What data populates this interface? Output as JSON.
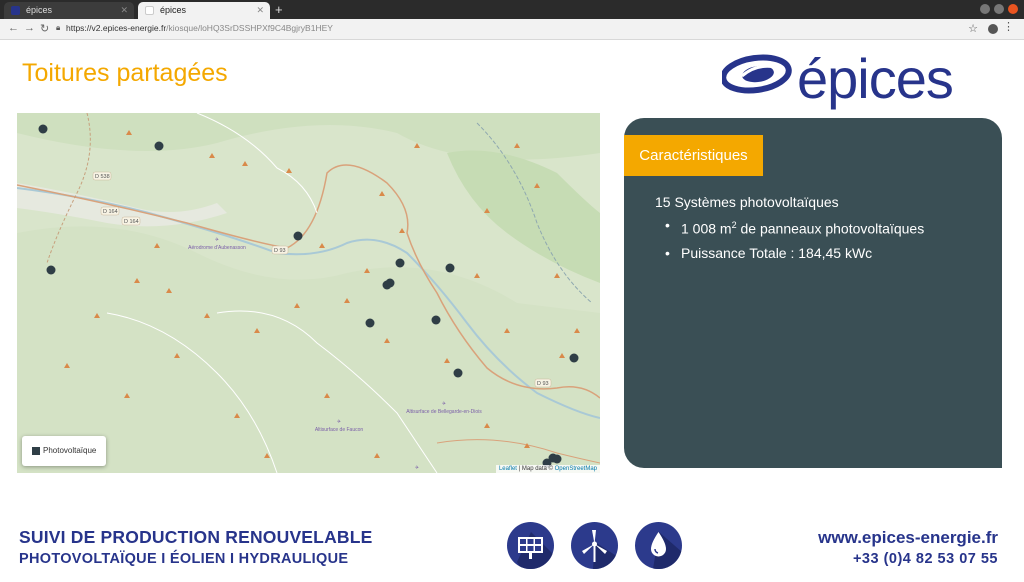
{
  "browser": {
    "tabs": [
      {
        "label": "épices",
        "active": false
      },
      {
        "label": "épices",
        "active": true
      }
    ],
    "url_host": "https://v2.epices-energie.fr",
    "url_path": "/kiosque/loHQ3SrDSSHPXf9C4BgjryB1HEY"
  },
  "page": {
    "title": "Toitures partagées",
    "logo_text": "épices"
  },
  "map": {
    "roads": [
      "D 538",
      "D 164",
      "D 164",
      "D 93",
      "D 93"
    ],
    "places": [
      "Aérodrome d'Aubenasson",
      "Altisurface de Bellegarde-en-Diois",
      "Altisurface de Faucon"
    ],
    "legend_label": "Photovoltaïque",
    "attribution_leaflet": "Leaflet",
    "attribution_sep": " | Map data © ",
    "attribution_osm": "OpenStreetMap",
    "marker_color": "#2f3e46"
  },
  "panel": {
    "tag": "Caractéristiques",
    "headline": "15 Systèmes photovoltaïques",
    "item1_pre": "1 008 m",
    "item1_sup": "2",
    "item1_post": " de panneaux photovoltaïques",
    "item2": "Puissance Totale : 184,45 kWc",
    "bullet": "•"
  },
  "footer": {
    "line1": "SUIVI DE PRODUCTION RENOUVELABLE",
    "line2": "PHOTOVOLTAÏQUE I ÉOLIEN I HYDRAULIQUE",
    "website": "www.epices-energie.fr",
    "phone": "+33 (0)4 82 53 07 55",
    "icons": [
      "solar-panel-icon",
      "wind-turbine-icon",
      "water-drop-icon"
    ]
  },
  "colors": {
    "accent": "#f4a800",
    "brand": "#27348b",
    "panel_bg": "#3a4f55"
  }
}
